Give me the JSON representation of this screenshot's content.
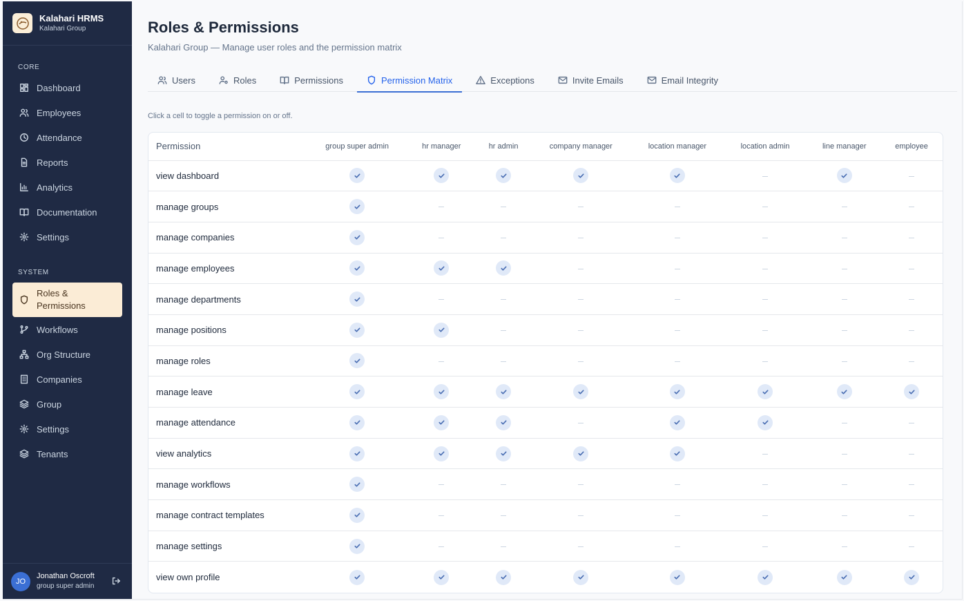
{
  "brand": {
    "name": "Kalahari HRMS",
    "sub": "Kalahari Group"
  },
  "sidebar": {
    "core_label": "CORE",
    "core": [
      {
        "label": "Dashboard",
        "icon": "dashboard-icon"
      },
      {
        "label": "Employees",
        "icon": "users-icon"
      },
      {
        "label": "Attendance",
        "icon": "clock-icon"
      },
      {
        "label": "Reports",
        "icon": "file-icon"
      },
      {
        "label": "Analytics",
        "icon": "bar-chart-icon"
      },
      {
        "label": "Documentation",
        "icon": "book-icon"
      },
      {
        "label": "Settings",
        "icon": "gear-icon"
      }
    ],
    "system_label": "SYSTEM",
    "system": [
      {
        "label": "Roles & Permissions",
        "icon": "shield-icon",
        "active": true
      },
      {
        "label": "Workflows",
        "icon": "git-branch-icon"
      },
      {
        "label": "Org Structure",
        "icon": "org-chart-icon"
      },
      {
        "label": "Companies",
        "icon": "building-icon"
      },
      {
        "label": "Group",
        "icon": "layers-icon"
      },
      {
        "label": "Settings",
        "icon": "gear-icon"
      },
      {
        "label": "Tenants",
        "icon": "layers-icon"
      }
    ]
  },
  "user": {
    "initials": "JO",
    "name": "Jonathan Oscroft",
    "role": "group super admin"
  },
  "header": {
    "title": "Roles & Permissions",
    "subtitle": "Kalahari Group — Manage user roles and the permission matrix"
  },
  "tabs": [
    {
      "label": "Users",
      "icon": "users-icon"
    },
    {
      "label": "Roles",
      "icon": "user-cog-icon"
    },
    {
      "label": "Permissions",
      "icon": "book-icon"
    },
    {
      "label": "Permission Matrix",
      "icon": "shield-icon",
      "active": true
    },
    {
      "label": "Exceptions",
      "icon": "warning-icon"
    },
    {
      "label": "Invite Emails",
      "icon": "mail-icon"
    },
    {
      "label": "Email Integrity",
      "icon": "mail-check-icon"
    }
  ],
  "hint": "Click a cell to toggle a permission on or off.",
  "matrix": {
    "permission_header": "Permission",
    "roles": [
      "group super admin",
      "hr manager",
      "hr admin",
      "company manager",
      "location manager",
      "location admin",
      "line manager",
      "employee"
    ],
    "rows": [
      {
        "permission": "view dashboard",
        "grants": [
          1,
          1,
          1,
          1,
          1,
          0,
          1,
          0
        ]
      },
      {
        "permission": "manage groups",
        "grants": [
          1,
          0,
          0,
          0,
          0,
          0,
          0,
          0
        ]
      },
      {
        "permission": "manage companies",
        "grants": [
          1,
          0,
          0,
          0,
          0,
          0,
          0,
          0
        ]
      },
      {
        "permission": "manage employees",
        "grants": [
          1,
          1,
          1,
          0,
          0,
          0,
          0,
          0
        ]
      },
      {
        "permission": "manage departments",
        "grants": [
          1,
          0,
          0,
          0,
          0,
          0,
          0,
          0
        ]
      },
      {
        "permission": "manage positions",
        "grants": [
          1,
          1,
          0,
          0,
          0,
          0,
          0,
          0
        ]
      },
      {
        "permission": "manage roles",
        "grants": [
          1,
          0,
          0,
          0,
          0,
          0,
          0,
          0
        ]
      },
      {
        "permission": "manage leave",
        "grants": [
          1,
          1,
          1,
          1,
          1,
          1,
          1,
          1
        ]
      },
      {
        "permission": "manage attendance",
        "grants": [
          1,
          1,
          1,
          0,
          1,
          1,
          0,
          0
        ]
      },
      {
        "permission": "view analytics",
        "grants": [
          1,
          1,
          1,
          1,
          1,
          0,
          0,
          0
        ]
      },
      {
        "permission": "manage workflows",
        "grants": [
          1,
          0,
          0,
          0,
          0,
          0,
          0,
          0
        ]
      },
      {
        "permission": "manage contract templates",
        "grants": [
          1,
          0,
          0,
          0,
          0,
          0,
          0,
          0
        ]
      },
      {
        "permission": "manage settings",
        "grants": [
          1,
          0,
          0,
          0,
          0,
          0,
          0,
          0
        ]
      },
      {
        "permission": "view own profile",
        "grants": [
          1,
          1,
          1,
          1,
          1,
          1,
          1,
          1
        ]
      }
    ]
  }
}
